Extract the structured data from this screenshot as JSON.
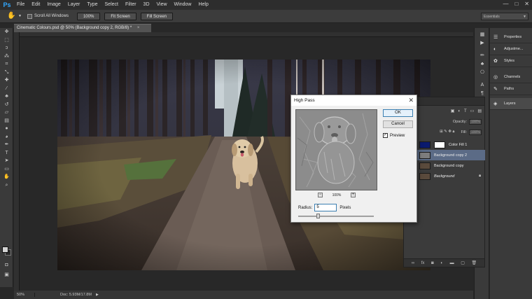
{
  "app": {
    "logo": "Ps",
    "menu": [
      "File",
      "Edit",
      "Image",
      "Layer",
      "Type",
      "Select",
      "Filter",
      "3D",
      "View",
      "Window",
      "Help"
    ],
    "window_controls": [
      "—",
      "□",
      "✕"
    ]
  },
  "options_bar": {
    "scroll_all_windows": "Scroll All Windows",
    "btn_zoom": "100%",
    "btn_fit": "Fit Screen",
    "btn_fill": "Fill Screen",
    "workspace": "Essentials"
  },
  "document": {
    "tab_title": "Cinematic Colours.psd @ 50% (Background copy 2, RGB/8) *",
    "tab_close": "×"
  },
  "status": {
    "zoom": "50%",
    "doc_size": "Doc: 5.93M/17.8M"
  },
  "right_panels": [
    {
      "icon": "properties-icon",
      "glyph": "☰",
      "label": "Properties"
    },
    {
      "icon": "adjustments-icon",
      "glyph": "◐",
      "label": "Adjustme..."
    },
    {
      "icon": "styles-icon",
      "glyph": "✿",
      "label": "Styles"
    },
    {
      "icon": "channels-icon",
      "glyph": "◎",
      "label": "Channels"
    },
    {
      "icon": "paths-icon",
      "glyph": "✎",
      "label": "Paths"
    },
    {
      "icon": "layers-icon",
      "glyph": "◈",
      "label": "Layers"
    }
  ],
  "layers_panel": {
    "opacity_label": "Opacity:",
    "opacity_value": "100%",
    "fill_label": "Fill:",
    "fill_value": "100%",
    "layers": [
      {
        "name": "Color Fill 1",
        "selected": false,
        "thumb": "#0a1a6e"
      },
      {
        "name": "Background copy 2",
        "selected": true,
        "thumb": "#7d7d7d"
      },
      {
        "name": "Background copy",
        "selected": false,
        "thumb": "#5a4a3c"
      },
      {
        "name": "Background",
        "selected": false,
        "thumb": "#5a4a3c"
      }
    ]
  },
  "dialog": {
    "title": "High Pass",
    "ok": "OK",
    "cancel": "Cancel",
    "preview_label": "Preview",
    "preview_checked": "✓",
    "zoom_percent": "100%",
    "zoom_out": "−",
    "zoom_in": "+",
    "radius_label": "Radius:",
    "radius_value": "5",
    "units": "Pixels"
  },
  "colors": {
    "ps_blue": "#31a8ff",
    "selection": "#5b6b86"
  }
}
